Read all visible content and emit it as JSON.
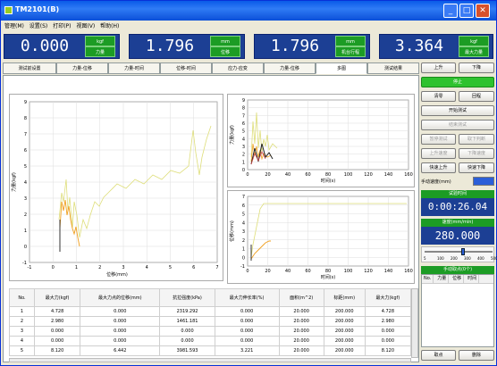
{
  "window": {
    "title": "TM2101(B)"
  },
  "menu": [
    "管理(M)",
    "设置(S)",
    "打印(P)",
    "视图(V)",
    "帮助(H)"
  ],
  "meters": [
    {
      "value": "0.000",
      "unit": "kgf",
      "label": "力量"
    },
    {
      "value": "1.796",
      "unit": "mm",
      "label": "位移"
    },
    {
      "value": "1.796",
      "unit": "mm",
      "label": "机台行程"
    },
    {
      "value": "3.364",
      "unit": "kgf",
      "label": "最大力量"
    }
  ],
  "tabs": [
    "测试前设置",
    "力量-位移",
    "力量-时间",
    "位移-时间",
    "应力-应变",
    "力量-位移",
    "多图",
    "测试结果"
  ],
  "active_tab": "多图",
  "table": {
    "headers": [
      "No.",
      "最大力(kgf)",
      "最大力点的位移(mm)",
      "抗拉强度(kPa)",
      "最大力伸长率(%)",
      "面积(m^2)",
      "标距(mm)",
      "最大力(kgf)"
    ],
    "rows": [
      [
        "1",
        "4.728",
        "0.000",
        "2319.292",
        "0.000",
        "20.000",
        "200.000",
        "4.728"
      ],
      [
        "2",
        "2.980",
        "0.000",
        "1461.181",
        "0.000",
        "20.000",
        "200.000",
        "2.980"
      ],
      [
        "3",
        "0.000",
        "0.000",
        "0.000",
        "0.000",
        "20.000",
        "200.000",
        "0.000"
      ],
      [
        "4",
        "0.000",
        "0.000",
        "0.000",
        "0.000",
        "20.000",
        "200.000",
        "0.000"
      ],
      [
        "5",
        "8.120",
        "6.442",
        "3981.593",
        "3.221",
        "20.000",
        "200.000",
        "8.120"
      ]
    ]
  },
  "controls": {
    "up": "上升",
    "down": "下降",
    "stop": "停止",
    "clear": "清零",
    "return": "回程",
    "start_test": "开始测试",
    "end_test": "结束测试",
    "pause_test": "暂停测试",
    "cancel_test": "取下判断",
    "up_speed": "上升速度",
    "down_speed": "下降速度",
    "fast_up": "快速上升",
    "fast_down": "快速下降",
    "speed_setting_label": "手动速度(mm)",
    "test_time_label": "试验时间",
    "test_time": "0:00:26.04",
    "speed_label": "速度(mm/min)",
    "speed_value": "280.000",
    "speed_ticks": [
      "5",
      "100",
      "200",
      "300",
      "400",
      "500"
    ],
    "manual_points_label": "手动取点(0个)",
    "mini_headers": [
      "No.",
      "力量",
      "位移",
      "时间"
    ],
    "take_point": "取点",
    "delete": "删除"
  },
  "charts": {
    "left": {
      "xlabel": "位移(mm)",
      "ylabel": "力量(kgf)",
      "xticks": [
        "-1",
        "0",
        "1",
        "2",
        "3",
        "4",
        "5",
        "6",
        "7"
      ],
      "yticks": [
        "-1",
        "0",
        "1",
        "2",
        "3",
        "4",
        "5",
        "6",
        "7",
        "8",
        "9"
      ]
    },
    "top_right": {
      "xlabel": "时间(s)",
      "ylabel": "力量(kgf)",
      "xticks": [
        "0",
        "20",
        "40",
        "60",
        "80",
        "100",
        "120",
        "140",
        "160"
      ],
      "yticks": [
        "0",
        "1",
        "2",
        "3",
        "4",
        "5",
        "6",
        "7",
        "8",
        "9"
      ]
    },
    "bottom_right": {
      "xlabel": "时间(s)",
      "ylabel": "位移(mm)",
      "xticks": [
        "0",
        "20",
        "40",
        "60",
        "80",
        "100",
        "120",
        "140",
        "160"
      ],
      "yticks": [
        "-1",
        "0",
        "1",
        "2",
        "3",
        "4",
        "5",
        "6",
        "7"
      ]
    }
  },
  "colors": {
    "meter_bg": "#1c3f94",
    "label_green": "#1c9c24",
    "curve_yellow": "#dede7a",
    "curve_orange": "#f0a020"
  }
}
